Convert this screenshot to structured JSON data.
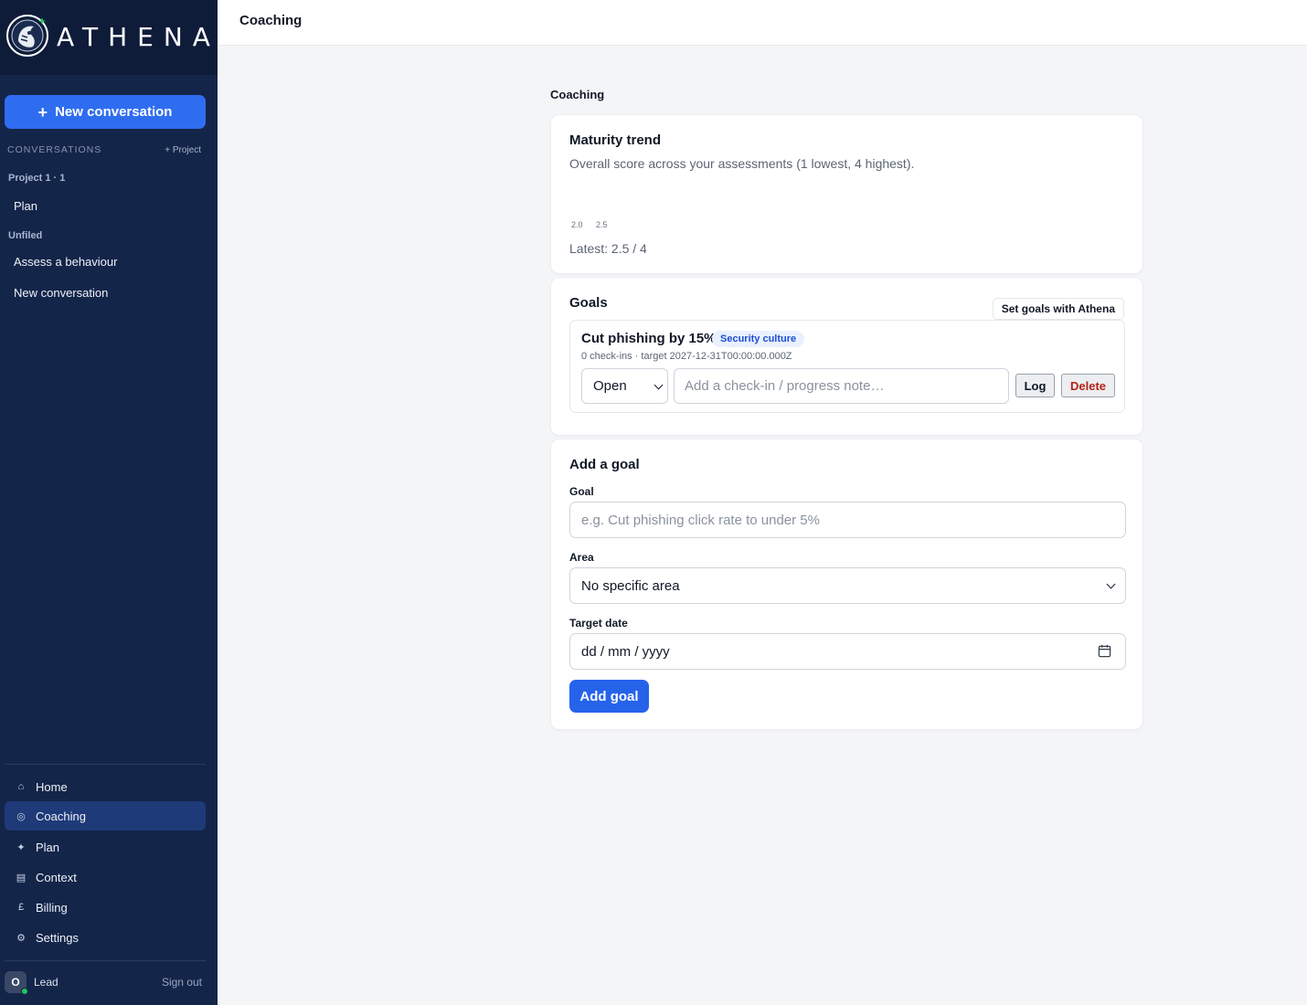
{
  "app": {
    "brand": "ATHENA",
    "new_conversation": "New conversation",
    "new_conversation_plus": "+"
  },
  "sidebar": {
    "conversations_label": "CONVERSATIONS",
    "add_project": "+ Project",
    "groups": [
      {
        "name": "Project 1 · 1",
        "items": [
          "Plan"
        ]
      },
      {
        "name": "Unfiled",
        "items": [
          "Assess a behaviour",
          "New conversation"
        ]
      }
    ],
    "nav": [
      {
        "icon": "⌂",
        "icon_name": "home-icon",
        "label": "Home",
        "active": false
      },
      {
        "icon": "◎",
        "icon_name": "coaching-icon",
        "label": "Coaching",
        "active": true
      },
      {
        "icon": "✦",
        "icon_name": "plan-icon",
        "label": "Plan",
        "active": false
      },
      {
        "icon": "▤",
        "icon_name": "context-icon",
        "label": "Context",
        "active": false
      },
      {
        "icon": "£",
        "icon_name": "billing-icon",
        "label": "Billing",
        "active": false
      },
      {
        "icon": "⚙",
        "icon_name": "settings-icon",
        "label": "Settings",
        "active": false
      }
    ],
    "user": {
      "initial": "O",
      "name": "Lead",
      "sign_out": "Sign out"
    }
  },
  "header": {
    "title": "Coaching"
  },
  "main": {
    "title": "Coaching",
    "maturity": {
      "title": "Maturity trend",
      "subtitle": "Overall score across your assessments (1 lowest, 4 highest).",
      "points": [
        "2.0",
        "2.5"
      ],
      "latest": "Latest: 2.5 / 4"
    },
    "goals": {
      "title": "Goals",
      "set_goals_button": "Set goals with Athena",
      "items": [
        {
          "title": "Cut phishing by 15%",
          "area": "Security culture",
          "meta": "0 check-ins · target 2027-12-31T00:00:00.000Z",
          "status": "Open",
          "checkin_placeholder": "Add a check-in / progress note…",
          "log_label": "Log",
          "delete_label": "Delete"
        }
      ]
    },
    "add_goal": {
      "title": "Add a goal",
      "goal_label": "Goal",
      "goal_placeholder": "e.g. Cut phishing click rate to under 5%",
      "area_label": "Area",
      "area_value": "No specific area",
      "target_label": "Target date",
      "target_placeholder": "dd / mm / yyyy",
      "submit": "Add goal"
    }
  },
  "colors": {
    "sidebar_bg": "#14254a",
    "sidebar_active": "#1e3a78",
    "primary": "#2563eb",
    "danger": "#b42318",
    "badge_bg": "#eaf1fe",
    "status_online": "#22c55e"
  }
}
